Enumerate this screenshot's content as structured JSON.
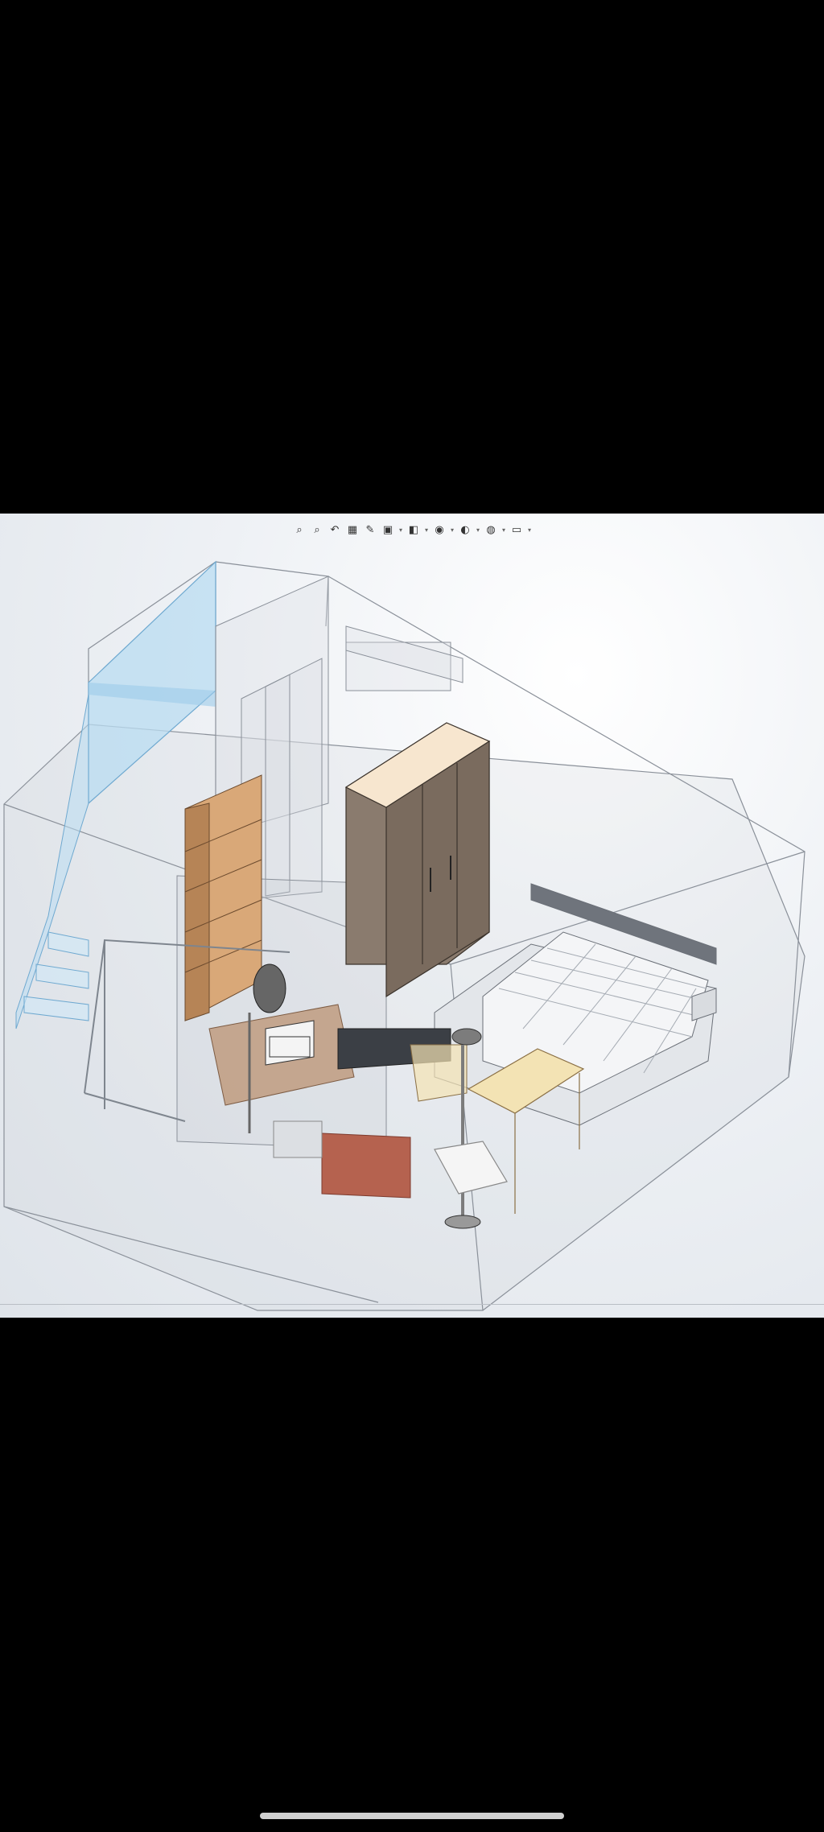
{
  "app": {
    "viewport_background": "#eef1f5",
    "edge_color": "#8a9099"
  },
  "heads_up_toolbar": {
    "tools": [
      {
        "icon": "zoom-to-fit-icon",
        "glyph": "⌕",
        "has_dropdown": false
      },
      {
        "icon": "zoom-to-area-icon",
        "glyph": "⌕",
        "has_dropdown": false
      },
      {
        "icon": "previous-view-icon",
        "glyph": "↶",
        "has_dropdown": false
      },
      {
        "icon": "section-view-icon",
        "glyph": "▦",
        "has_dropdown": false
      },
      {
        "icon": "dynamic-annotation-icon",
        "glyph": "✎",
        "has_dropdown": false
      },
      {
        "icon": "view-orientation-icon",
        "glyph": "▣",
        "has_dropdown": true
      },
      {
        "icon": "display-style-icon",
        "glyph": "◧",
        "has_dropdown": true
      },
      {
        "icon": "hide-show-items-icon",
        "glyph": "◉",
        "has_dropdown": true
      },
      {
        "icon": "edit-appearance-icon",
        "glyph": "◐",
        "has_dropdown": true
      },
      {
        "icon": "apply-scene-icon",
        "glyph": "◍",
        "has_dropdown": true
      },
      {
        "icon": "view-settings-icon",
        "glyph": "▭",
        "has_dropdown": true
      }
    ]
  },
  "model": {
    "stair_fill": "#b9dcf2",
    "wood_color": "#d9a878",
    "wardrobe_color": "#8a7b6e",
    "mattress_color": "#f4f5f7",
    "desk_top_color": "#f3e3b4",
    "rug_color": "#b5624f"
  }
}
